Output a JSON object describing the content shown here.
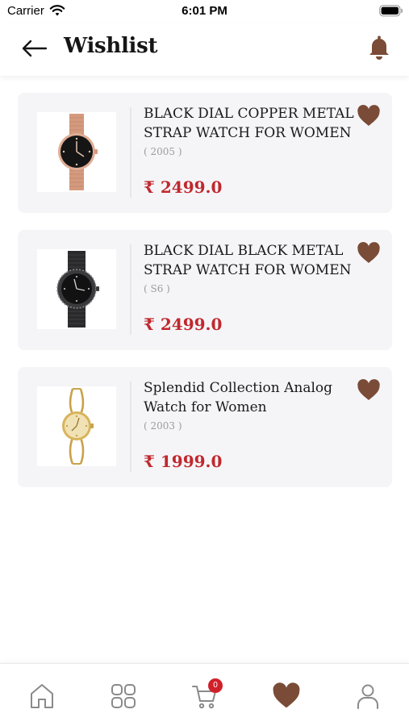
{
  "status_bar": {
    "carrier": "Carrier",
    "time": "6:01 PM"
  },
  "header": {
    "title": "Wishlist",
    "back_icon": "arrow-left-icon",
    "notification_icon": "bell-icon"
  },
  "colors": {
    "accent_brown": "#7a4b36",
    "price_red": "#c0282d",
    "card_bg": "#f5f5f8",
    "badge_red": "#d0202a"
  },
  "wishlist": [
    {
      "name": "BLACK DIAL COPPER METAL STRAP WATCH FOR WOMEN",
      "code": "( 2005 )",
      "price": "₹ 2499.0",
      "image": "rose-gold-mesh-watch",
      "favorite_icon": "heart-filled-icon"
    },
    {
      "name": "BLACK DIAL BLACK METAL STRAP WATCH FOR WOMEN",
      "code": "( S6 )",
      "price": "₹ 2499.0",
      "image": "black-mesh-watch",
      "favorite_icon": "heart-filled-icon"
    },
    {
      "name": "Splendid Collection Analog Watch for Women",
      "code": "( 2003 )",
      "price": "₹ 1999.0",
      "image": "gold-bracelet-watch",
      "favorite_icon": "heart-filled-icon"
    }
  ],
  "bottom_nav": {
    "items": [
      {
        "name": "home",
        "icon": "home-icon",
        "active": false
      },
      {
        "name": "categories",
        "icon": "grid-icon",
        "active": false
      },
      {
        "name": "cart",
        "icon": "cart-icon",
        "active": false
      },
      {
        "name": "wishlist",
        "icon": "heart-filled-icon",
        "active": true
      },
      {
        "name": "profile",
        "icon": "user-icon",
        "active": false
      }
    ],
    "cart_count": "0"
  }
}
